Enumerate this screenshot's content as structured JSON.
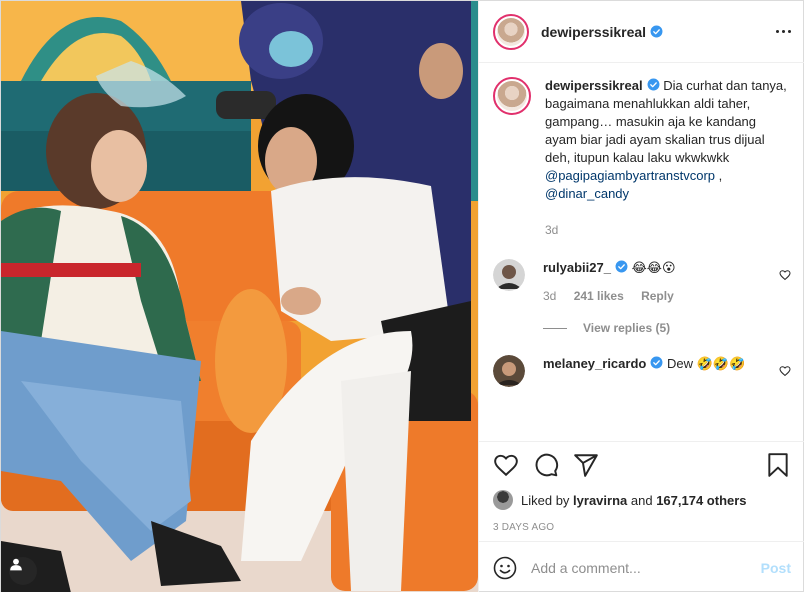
{
  "post": {
    "username": "dewiperssikreal",
    "verified": true
  },
  "caption": {
    "username": "dewiperssikreal",
    "text": "Dia curhat dan tanya, bagaimana menahlukkan aldi taher, gampang… masukin aja ke kandang ayam biar jadi ayam skalian trus dijual deh, itupun kalau laku wkwkwkk",
    "mentions": [
      "@pagipagiambyartranstvcorp",
      "@dinar_candy"
    ],
    "separator": " ,",
    "age": "3d"
  },
  "comments": [
    {
      "username": "rulyabii27_",
      "text": "😂😂😮",
      "age": "3d",
      "likes": "241 likes",
      "reply_label": "Reply",
      "view_replies": "View replies (5)"
    },
    {
      "username": "melaney_ricardo",
      "text": "Dew 🤣🤣🤣"
    }
  ],
  "likes": {
    "prefix": "Liked by",
    "user": "lyravirna",
    "joiner": "and",
    "others": "167,174 others"
  },
  "timestamp": "3 DAYS AGO",
  "add_comment": {
    "placeholder": "Add a comment...",
    "post_label": "Post"
  },
  "colors": {
    "verified": "#3897f0",
    "link": "#00376b",
    "muted": "#8e8e8e",
    "post_disabled": "#b2dffc"
  },
  "icons": [
    "heart-icon",
    "comment-icon",
    "share-icon",
    "bookmark-icon",
    "emoji-icon",
    "more-icon",
    "user-tag-icon",
    "verified-badge-icon"
  ]
}
